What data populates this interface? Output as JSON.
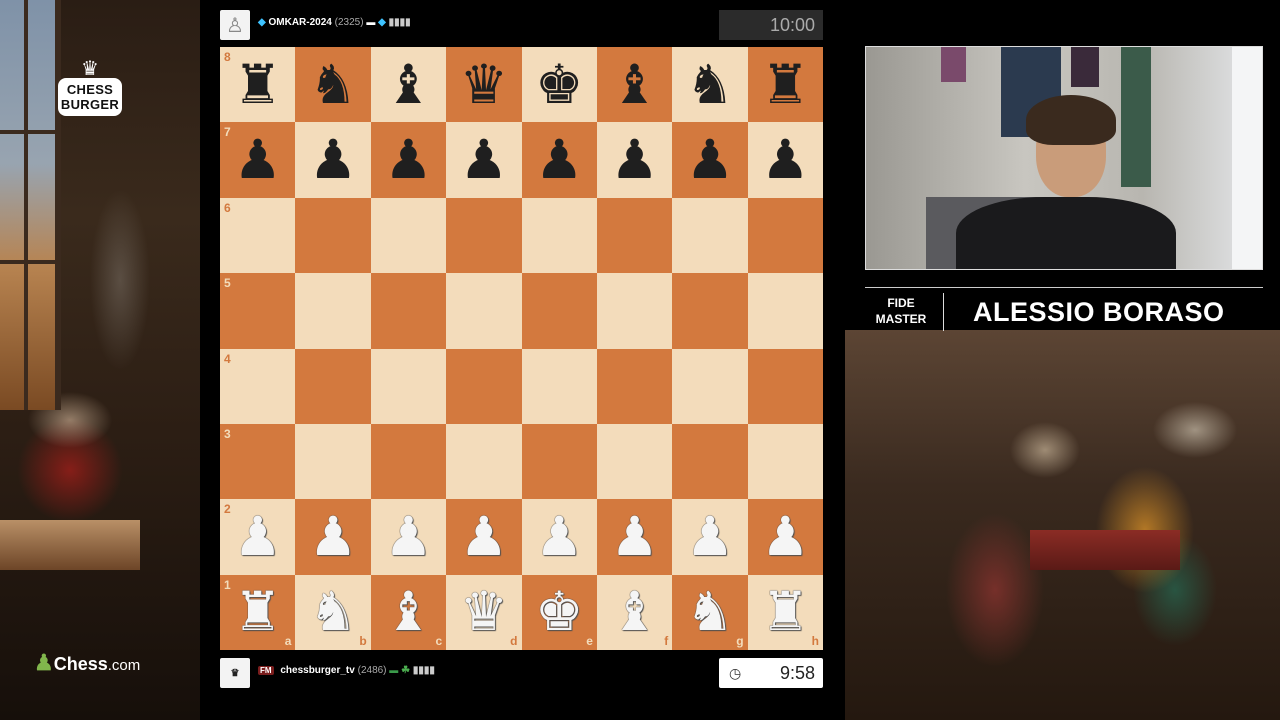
{
  "branding": {
    "logo_top": "CHESS",
    "logo_bottom": "BURGER",
    "site_name": "Chess",
    "site_suffix": ".com"
  },
  "top_player": {
    "name": "OMKAR-2024",
    "rating": "(2325)",
    "clock": "10:00"
  },
  "bottom_player": {
    "title": "FM",
    "name": "chessburger_tv",
    "rating": "(2486)",
    "clock": "9:58"
  },
  "board": {
    "ranks": [
      "8",
      "7",
      "6",
      "5",
      "4",
      "3",
      "2",
      "1"
    ],
    "files": [
      "a",
      "b",
      "c",
      "d",
      "e",
      "f",
      "g",
      "h"
    ],
    "position": [
      [
        "r",
        "n",
        "b",
        "q",
        "k",
        "b",
        "n",
        "r"
      ],
      [
        "p",
        "p",
        "p",
        "p",
        "p",
        "p",
        "p",
        "p"
      ],
      [
        "",
        "",
        "",
        "",
        "",
        "",
        "",
        ""
      ],
      [
        "",
        "",
        "",
        "",
        "",
        "",
        "",
        ""
      ],
      [
        "",
        "",
        "",
        "",
        "",
        "",
        "",
        ""
      ],
      [
        "",
        "",
        "",
        "",
        "",
        "",
        "",
        ""
      ],
      [
        "P",
        "P",
        "P",
        "P",
        "P",
        "P",
        "P",
        "P"
      ],
      [
        "R",
        "N",
        "B",
        "Q",
        "K",
        "B",
        "N",
        "R"
      ]
    ]
  },
  "commentator": {
    "title_line1": "FIDE",
    "title_line2": "MASTER",
    "name": "ALESSIO BORASO"
  },
  "colors": {
    "light_square": "#f3dcbb",
    "dark_square": "#d3793e",
    "chesscom_green": "#81b64c"
  }
}
